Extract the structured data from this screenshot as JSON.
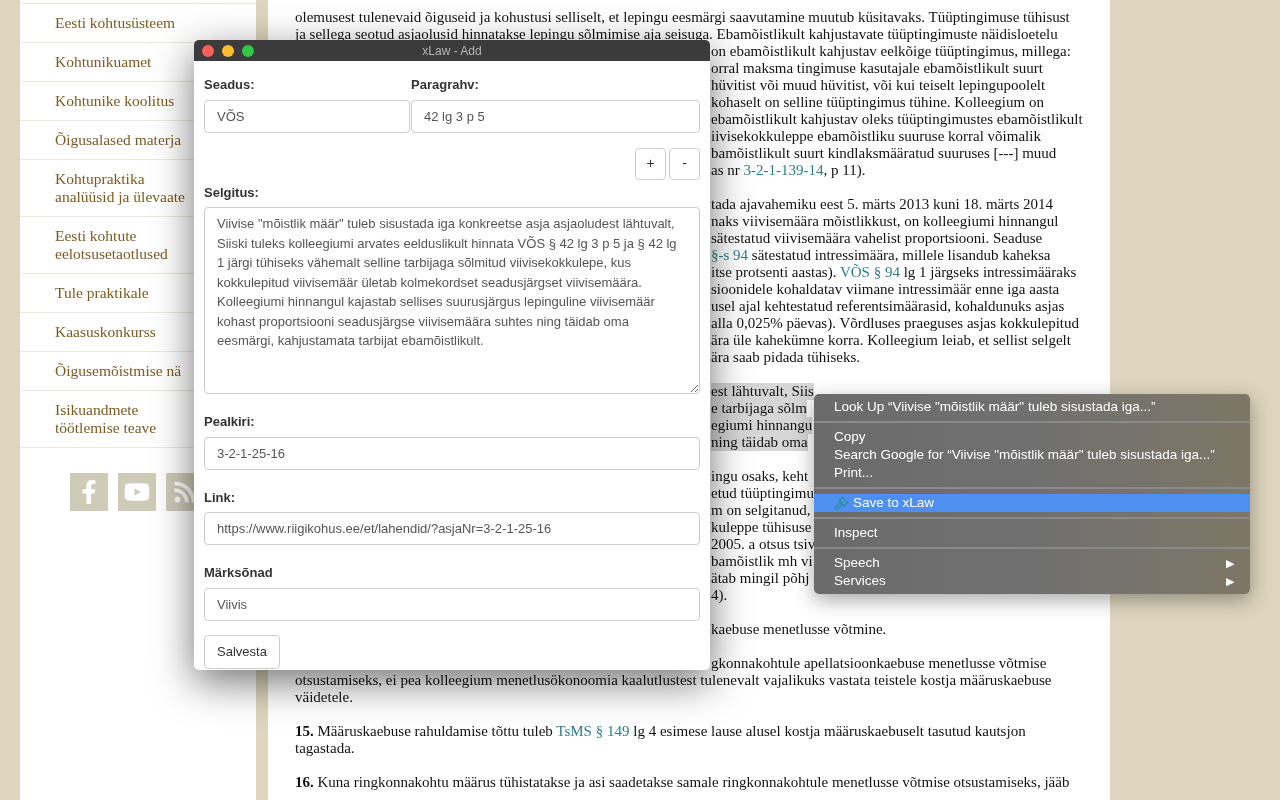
{
  "sidebar": {
    "items": [
      {
        "label": "Eesti kohtusüsteem"
      },
      {
        "label": "Kohtunikuamet"
      },
      {
        "label": "Kohtunike koolitus"
      },
      {
        "label": "Õigusalased materja"
      },
      {
        "label": "Kohtupraktika\nanalüüsid ja ülevaate"
      },
      {
        "label": "Eesti kohtute\neelotsusetaotlused"
      },
      {
        "label": "Tule praktikale"
      },
      {
        "label": "Kaasuskonkurss"
      },
      {
        "label": "Õigusemõistmise nä"
      },
      {
        "label": "Isikuandmete\ntöötlemise teave"
      }
    ],
    "social": [
      {
        "kind": "facebook"
      },
      {
        "kind": "youtube"
      },
      {
        "kind": "rss"
      }
    ]
  },
  "article": {
    "paragraphs": [
      {
        "lines": [
          {
            "kind": "full",
            "selected": false,
            "parts": [
              {
                "text": "olemusest tulenevaid õiguseid ja kohustusi selliselt, et lepingu eesmärgi saavutamine muutub küsitavaks. Tüüptingimuse tühisust"
              }
            ]
          },
          {
            "kind": "full",
            "selected": false,
            "parts": [
              {
                "text": "ja sellega seotud asjaolusid hinnatakse lepingu sõlmimise aja seisuga. Ebamõistlikult kahjustavate tüüptingimuste näidisloetelu"
              }
            ]
          },
          {
            "kind": "clipped",
            "selected": false,
            "parts": [
              {
                "text": "on ebamõistlikult kahjustav eelkõige tüüptingimus, millega:"
              }
            ]
          },
          {
            "kind": "clipped",
            "selected": false,
            "parts": [
              {
                "text": "orral maksma tingimuse kasutajale ebamõistlikult suurt"
              }
            ]
          },
          {
            "kind": "clipped",
            "selected": false,
            "parts": [
              {
                "text": "hüvitist või muud hüvitist, või kui teiselt lepingupoolelt"
              }
            ]
          },
          {
            "kind": "clipped",
            "selected": false,
            "parts": [
              {
                "text": "kohaselt on selline tüüptingimus tühine. Kolleegium on"
              }
            ]
          },
          {
            "kind": "clipped",
            "selected": false,
            "parts": [
              {
                "text": "ebamõistlikult kahjustav oleks tüüptingimustes ebamõistlikult"
              }
            ]
          },
          {
            "kind": "clipped",
            "selected": false,
            "parts": [
              {
                "text": "iivisekokkuleppe ebamõistliku suuruse korral võimalik"
              }
            ]
          },
          {
            "kind": "clipped",
            "selected": false,
            "parts": [
              {
                "text": "bamõistlikult suurt kindlaksmääratud suuruses [---] muud"
              }
            ]
          },
          {
            "kind": "clipped",
            "selected": false,
            "parts": [
              {
                "text": "as nr "
              },
              {
                "text": "3-2-1-139-14",
                "kind": "link"
              },
              {
                "text": ", p 11)."
              }
            ]
          }
        ]
      },
      {
        "lines": [
          {
            "kind": "clipped",
            "selected": false,
            "parts": [
              {
                "text": "tada ajavahemiku eest 5. märts 2013 kuni 18. märts 2014"
              }
            ]
          },
          {
            "kind": "clipped",
            "selected": false,
            "parts": [
              {
                "text": "naks viivisemäära mõistlikkust, on kolleegiumi hinnangul"
              }
            ]
          },
          {
            "kind": "clipped",
            "selected": false,
            "parts": [
              {
                "text": "sätestatud viivisemäära vahelist proportsiooni. Seaduse"
              }
            ]
          },
          {
            "kind": "clipped",
            "selected": false,
            "parts": [
              {
                "text": "§-s 94",
                "kind": "link"
              },
              {
                "text": " sätestatud intressimäära, millele lisandub kaheksa"
              }
            ]
          },
          {
            "kind": "clipped",
            "selected": false,
            "parts": [
              {
                "text": "itse protsenti aastas). "
              },
              {
                "text": "VÕS § 94",
                "kind": "link"
              },
              {
                "text": " lg 1 järgseks intressimääraks"
              }
            ]
          },
          {
            "kind": "clipped",
            "selected": false,
            "parts": [
              {
                "text": "sioonidele kohaldatav viimane intressimäär enne iga aasta"
              }
            ]
          },
          {
            "kind": "clipped",
            "selected": false,
            "parts": [
              {
                "text": "usel ajal kehtestatud referentsimäärasid, kohaldunuks asjas"
              }
            ]
          },
          {
            "kind": "clipped",
            "selected": false,
            "parts": [
              {
                "text": "alla 0,025% päevas). Võrdluses praeguses asjas kokkulepitud"
              }
            ]
          },
          {
            "kind": "clipped",
            "selected": false,
            "parts": [
              {
                "text": "ära üle kahekümne korra. Kolleegium leiab, et sellist selgelt"
              }
            ]
          },
          {
            "kind": "clipped",
            "selected": false,
            "parts": [
              {
                "text": "ära saab pidada tühiseks."
              }
            ]
          }
        ]
      },
      {
        "lines": [
          {
            "kind": "clipped",
            "selected": true,
            "parts": [
              {
                "text": "est lähtuvalt, Siis"
              }
            ]
          },
          {
            "kind": "clipped",
            "selected": true,
            "parts": [
              {
                "text": "e tarbijaga sõlm"
              }
            ]
          },
          {
            "kind": "clipped",
            "selected": true,
            "parts": [
              {
                "text": "egiumi hinnangu"
              }
            ]
          },
          {
            "kind": "clipped",
            "selected": true,
            "parts": [
              {
                "text": "ning täidab oma"
              }
            ]
          }
        ]
      },
      {
        "lines": [
          {
            "kind": "clipped",
            "selected": false,
            "parts": [
              {
                "text": "ingu osaks, keht"
              }
            ]
          },
          {
            "kind": "clipped",
            "selected": false,
            "parts": [
              {
                "text": "etud tüüptingimu"
              }
            ]
          },
          {
            "kind": "clipped",
            "selected": false,
            "parts": [
              {
                "text": "m on selgitanud,"
              }
            ]
          },
          {
            "kind": "clipped",
            "selected": false,
            "parts": [
              {
                "text": "kuleppe tühisuse"
              }
            ]
          },
          {
            "kind": "clipped",
            "selected": false,
            "parts": [
              {
                "text": "2005. a otsus tsiv"
              }
            ]
          },
          {
            "kind": "clipped",
            "selected": false,
            "parts": [
              {
                "text": "bamõistlik mh vi"
              }
            ]
          },
          {
            "kind": "clipped",
            "selected": false,
            "parts": [
              {
                "text": "ätab mingil põhj"
              }
            ]
          },
          {
            "kind": "clipped",
            "selected": false,
            "parts": [
              {
                "text": "4)."
              }
            ]
          }
        ]
      },
      {
        "lines": [
          {
            "kind": "clipped",
            "selected": false,
            "parts": [
              {
                "text": "kaebuse menetlusse võtmine."
              }
            ]
          }
        ]
      },
      {
        "lines": [
          {
            "kind": "clipped",
            "selected": false,
            "parts": [
              {
                "text": "gkonnakohtule apellatsioonkaebuse menetlusse võtmise"
              }
            ]
          },
          {
            "kind": "full",
            "selected": false,
            "parts": [
              {
                "text": "otsustamiseks, ei pea kolleegium menetlusökonoomia kaalutlustest tulenevalt vajalikuks vastata teistele kostja määruskaebuse"
              }
            ]
          },
          {
            "kind": "full",
            "selected": false,
            "parts": [
              {
                "text": "väidetele."
              }
            ]
          }
        ]
      },
      {
        "lines": [
          {
            "kind": "full",
            "selected": false,
            "parts": [
              {
                "text": "**15.** Määruskaebuse rahuldamise tõttu tuleb "
              },
              {
                "text": "TsMS § 149",
                "kind": "link"
              },
              {
                "text": " lg 4 esimese lause alusel kostja määruskaebuselt tasutud kautsjon"
              }
            ]
          },
          {
            "kind": "full",
            "selected": false,
            "parts": [
              {
                "text": "tagastada."
              }
            ]
          }
        ]
      },
      {
        "lines": [
          {
            "kind": "full",
            "selected": false,
            "parts": [
              {
                "text": "**16.** Kuna ringkonnakohtu määrus tühistatakse ja asi saadetakse samale ringkonnakohtule menetlusse võtmise otsustamiseks, jääb"
              }
            ]
          }
        ]
      }
    ]
  },
  "dialog": {
    "title": "xLaw - Add",
    "seadus": {
      "label": "Seadus:",
      "value": "VÕS"
    },
    "paragrahv": {
      "label": "Paragrahv:",
      "value": "42 lg 3 p 5"
    },
    "buttons_small": [
      "+",
      "-"
    ],
    "selgitus": {
      "label": "Selgitus:",
      "value": "Viivise \"mõistlik määr\" tuleb sisustada iga konkreetse asja asjaoludest lähtuvalt, Siiski tuleks kolleegiumi arvates eelduslikult hinnata VÕS § 42 lg 3 p 5 ja § 42 lg 1 järgi tühiseks vähemalt selline tarbijaga sõlmitud viivisekokkulepe, kus kokkulepitud viivisemäär ületab kolmekordset seadusjärgset viivisemäära. Kolleegiumi hinnangul kajastab sellises suurusjärgus lepinguline viivisemäär kohast proportsiooni seadusjärgse viivisemäära suhtes ning täidab oma eesmärgi, kahjustamata tarbijat ebamõistlikult."
    },
    "pealkiri": {
      "label": "Pealkiri:",
      "value": "3-2-1-25-16"
    },
    "link": {
      "label": "Link:",
      "value": "https://www.riigikohus.ee/et/lahendid/?asjaNr=3-2-1-25-16"
    },
    "marksonad": {
      "label": "Märksõnad",
      "value": "Viivis"
    },
    "save": "Salvesta"
  },
  "context_menu": {
    "items": [
      {
        "kind": "item",
        "label": "Look Up “Viivise \"mõistlik määr\" tuleb sisustada iga...”",
        "selected": false
      },
      {
        "kind": "separator"
      },
      {
        "kind": "item",
        "label": "Copy",
        "selected": false
      },
      {
        "kind": "item",
        "label": "Search Google for “Viivise \"mõistlik määr\" tuleb sisustada iga...”",
        "selected": false
      },
      {
        "kind": "item",
        "label": "Print...",
        "selected": false
      },
      {
        "kind": "separator"
      },
      {
        "kind": "icon_item",
        "label": "Save to xLaw",
        "selected": true
      },
      {
        "kind": "separator"
      },
      {
        "kind": "item",
        "label": "Inspect",
        "selected": false
      },
      {
        "kind": "separator"
      },
      {
        "kind": "submenu",
        "label": "Speech",
        "arrow": "▶",
        "selected": false
      },
      {
        "kind": "submenu",
        "label": "Services",
        "arrow": "▶",
        "selected": false
      }
    ]
  }
}
